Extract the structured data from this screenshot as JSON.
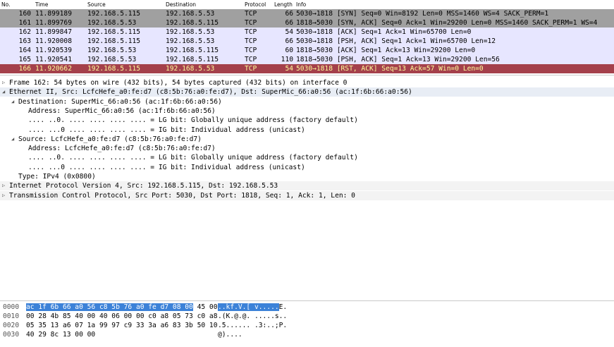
{
  "columns": {
    "no": "No.",
    "time": "Time",
    "source": "Source",
    "destination": "Destination",
    "protocol": "Protocol",
    "length": "Length",
    "info": "Info"
  },
  "packets": [
    {
      "no": "160",
      "time": "11.899189",
      "src": "192.168.5.115",
      "dst": "192.168.5.53",
      "proto": "TCP",
      "len": "66",
      "info": "5030→1818 [SYN] Seq=0 Win=8192 Len=0 MSS=1460 WS=4 SACK_PERM=1",
      "bg": "#a0a0a0"
    },
    {
      "no": "161",
      "time": "11.899769",
      "src": "192.168.5.53",
      "dst": "192.168.5.115",
      "proto": "TCP",
      "len": "66",
      "info": "1818→5030 [SYN, ACK] Seq=0 Ack=1 Win=29200 Len=0 MSS=1460 SACK_PERM=1 WS=4",
      "bg": "#a0a0a0"
    },
    {
      "no": "162",
      "time": "11.899847",
      "src": "192.168.5.115",
      "dst": "192.168.5.53",
      "proto": "TCP",
      "len": "54",
      "info": "5030→1818 [ACK] Seq=1 Ack=1 Win=65700 Len=0",
      "bg": "#e7e6ff"
    },
    {
      "no": "163",
      "time": "11.920008",
      "src": "192.168.5.115",
      "dst": "192.168.5.53",
      "proto": "TCP",
      "len": "66",
      "info": "5030→1818 [PSH, ACK] Seq=1 Ack=1 Win=65700 Len=12",
      "bg": "#e7e6ff"
    },
    {
      "no": "164",
      "time": "11.920539",
      "src": "192.168.5.53",
      "dst": "192.168.5.115",
      "proto": "TCP",
      "len": "60",
      "info": "1818→5030 [ACK] Seq=1 Ack=13 Win=29200 Len=0",
      "bg": "#e7e6ff"
    },
    {
      "no": "165",
      "time": "11.920541",
      "src": "192.168.5.53",
      "dst": "192.168.5.115",
      "proto": "TCP",
      "len": "110",
      "info": "1818→5030 [PSH, ACK] Seq=1 Ack=13 Win=29200 Len=56",
      "bg": "#e7e6ff"
    },
    {
      "no": "166",
      "time": "11.920662",
      "src": "192.168.5.115",
      "dst": "192.168.5.53",
      "proto": "TCP",
      "len": "54",
      "info": "5030→1818 [RST, ACK] Seq=13 Ack=57 Win=0 Len=0",
      "bg": "#a4404b",
      "fg": "#fefe9c"
    }
  ],
  "details": [
    {
      "indent": 0,
      "arrow": "▷",
      "text": "Frame 162: 54 bytes on wire (432 bits), 54 bytes captured (432 bits) on interface 0",
      "bg": "#ffffff"
    },
    {
      "indent": 0,
      "arrow": "◢",
      "text": "Ethernet II, Src: LcfcHefe_a0:fe:d7 (c8:5b:76:a0:fe:d7), Dst: SuperMic_66:a0:56 (ac:1f:6b:66:a0:56)",
      "bg": "#e8edf5"
    },
    {
      "indent": 1,
      "arrow": "◢",
      "text": "Destination: SuperMic_66:a0:56 (ac:1f:6b:66:a0:56)",
      "bg": "#ffffff"
    },
    {
      "indent": 2,
      "arrow": "",
      "text": "Address: SuperMic_66:a0:56 (ac:1f:6b:66:a0:56)",
      "bg": "#ffffff"
    },
    {
      "indent": 2,
      "arrow": "",
      "text": ".... ..0. .... .... .... .... = LG bit: Globally unique address (factory default)",
      "bg": "#ffffff"
    },
    {
      "indent": 2,
      "arrow": "",
      "text": ".... ...0 .... .... .... .... = IG bit: Individual address (unicast)",
      "bg": "#ffffff"
    },
    {
      "indent": 1,
      "arrow": "◢",
      "text": "Source: LcfcHefe_a0:fe:d7 (c8:5b:76:a0:fe:d7)",
      "bg": "#ffffff"
    },
    {
      "indent": 2,
      "arrow": "",
      "text": "Address: LcfcHefe_a0:fe:d7 (c8:5b:76:a0:fe:d7)",
      "bg": "#ffffff"
    },
    {
      "indent": 2,
      "arrow": "",
      "text": ".... ..0. .... .... .... .... = LG bit: Globally unique address (factory default)",
      "bg": "#ffffff"
    },
    {
      "indent": 2,
      "arrow": "",
      "text": ".... ...0 .... .... .... .... = IG bit: Individual address (unicast)",
      "bg": "#ffffff"
    },
    {
      "indent": 1,
      "arrow": "",
      "text": "Type: IPv4 (0x0800)",
      "bg": "#ffffff"
    },
    {
      "indent": 0,
      "arrow": "▷",
      "text": "Internet Protocol Version 4, Src: 192.168.5.115, Dst: 192.168.5.53",
      "bg": "#f3f3f3"
    },
    {
      "indent": 0,
      "arrow": "▷",
      "text": "Transmission Control Protocol, Src Port: 5030, Dst Port: 1818, Seq: 1, Ack: 1, Len: 0",
      "bg": "#f3f3f3"
    }
  ],
  "hexdump": [
    {
      "offset": "0000",
      "hex_hl": "ac 1f 6b 66 a0 56 c8 5b  76 a0 fe d7 08 00",
      "hex_rest": " 45 00",
      "ascii_hl": "..kf.V.[ v.....",
      "ascii_rest": "E."
    },
    {
      "offset": "0010",
      "hex_hl": "",
      "hex_rest": "00 28 4b 85 40 00 40 06  00 00 c0 a8 05 73 c0 a8",
      "ascii_hl": "",
      "ascii_rest": ".(K.@.@. .....s.."
    },
    {
      "offset": "0020",
      "hex_hl": "",
      "hex_rest": "05 35 13 a6 07 1a 99 97  c9 33 3a a6 83 3b 50 10",
      "ascii_hl": "",
      "ascii_rest": ".5...... .3:..;P."
    },
    {
      "offset": "0030",
      "hex_hl": "",
      "hex_rest": "40 29 8c 13 00 00",
      "ascii_hl": "",
      "ascii_rest": "@)...."
    }
  ]
}
